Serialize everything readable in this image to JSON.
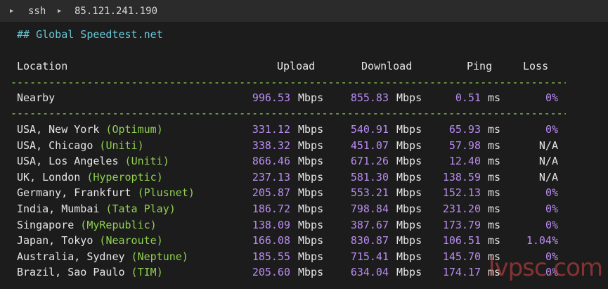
{
  "tab": {
    "command": "ssh",
    "host": "85.121.241.190"
  },
  "title": "## Global Speedtest.net",
  "headers": {
    "location": "Location",
    "upload": "Upload",
    "download": "Download",
    "ping": "Ping",
    "loss": "Loss"
  },
  "separator": "------------------------------------------------------------------------------------------------",
  "units": {
    "speed": "Mbps",
    "ping": "ms"
  },
  "nearby": {
    "location": "Nearby",
    "upload": "996.53",
    "download": "855.83",
    "ping": "0.51",
    "loss": "0%"
  },
  "rows": [
    {
      "place": "USA, New York",
      "isp": "Optimum",
      "upload": "331.12",
      "download": "540.91",
      "ping": "65.93",
      "loss": "0%"
    },
    {
      "place": "USA, Chicago",
      "isp": "Uniti",
      "upload": "338.32",
      "download": "451.07",
      "ping": "57.98",
      "loss": "N/A"
    },
    {
      "place": "USA, Los Angeles",
      "isp": "Uniti",
      "upload": "866.46",
      "download": "671.26",
      "ping": "12.40",
      "loss": "N/A"
    },
    {
      "place": "UK, London",
      "isp": "Hyperoptic",
      "upload": "237.13",
      "download": "581.30",
      "ping": "138.59",
      "loss": "N/A"
    },
    {
      "place": "Germany, Frankfurt",
      "isp": "Plusnet",
      "upload": "205.87",
      "download": "553.21",
      "ping": "152.13",
      "loss": "0%"
    },
    {
      "place": "India, Mumbai",
      "isp": "Tata Play",
      "upload": "186.72",
      "download": "798.84",
      "ping": "231.20",
      "loss": "0%"
    },
    {
      "place": "Singapore",
      "isp": "MyRepublic",
      "upload": "138.09",
      "download": "387.67",
      "ping": "173.79",
      "loss": "0%"
    },
    {
      "place": "Japan, Tokyo",
      "isp": "Nearoute",
      "upload": "166.08",
      "download": "830.87",
      "ping": "106.51",
      "loss": "1.04%"
    },
    {
      "place": "Australia, Sydney",
      "isp": "Neptune",
      "upload": "185.55",
      "download": "715.41",
      "ping": "145.70",
      "loss": "0%"
    },
    {
      "place": "Brazil, Sao Paulo",
      "isp": "TIM",
      "upload": "205.60",
      "download": "634.04",
      "ping": "174.17",
      "loss": "0%"
    }
  ],
  "watermark": "lvpsc.com",
  "colors": {
    "title": "#67c7d6",
    "separator": "#8fd14f",
    "isp": "#8fd14f",
    "numbers": "#b98cf0",
    "background": "#1c1c1c"
  }
}
